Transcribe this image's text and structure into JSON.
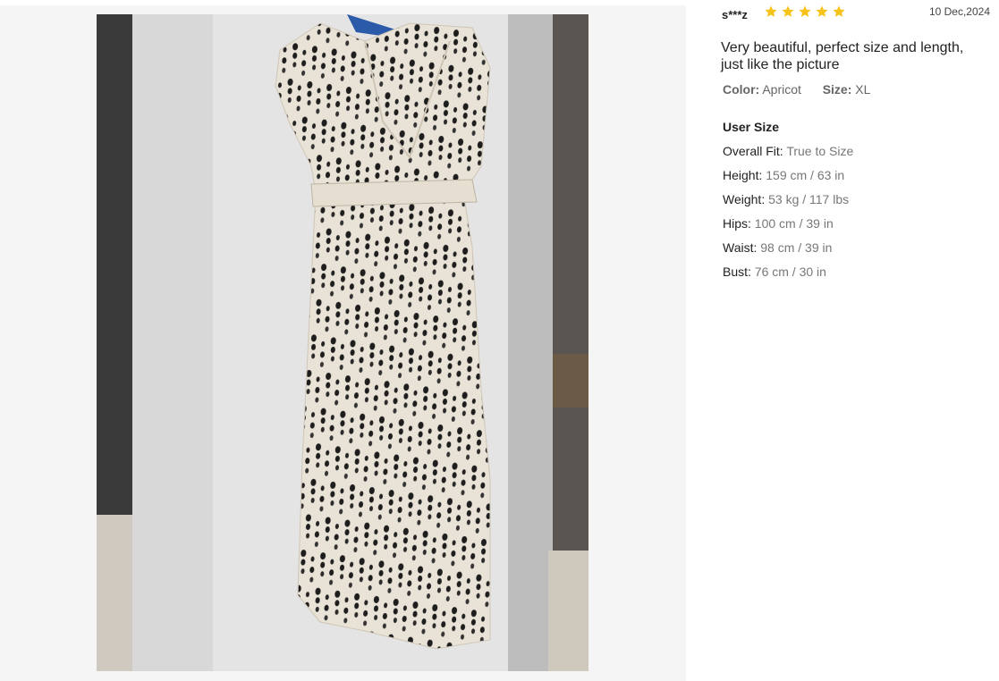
{
  "photo": {
    "subject": "dress-photo"
  },
  "review": {
    "reviewer": "s***z",
    "rating": 5,
    "rating_max": 5,
    "star_color": "#f7c31a",
    "date": "10 Dec,2024",
    "text": "Very beautiful, perfect size and length, just like the picture",
    "attributes": {
      "color_label": "Color:",
      "color_value": "Apricot",
      "size_label": "Size:",
      "size_value": "XL"
    },
    "user_size": {
      "title": "User Size",
      "rows": [
        {
          "label": "Overall Fit:",
          "value": "True to Size"
        },
        {
          "label": "Height:",
          "value": "159 cm / 63 in"
        },
        {
          "label": "Weight:",
          "value": "53 kg / 117 lbs"
        },
        {
          "label": "Hips:",
          "value": "100 cm / 39 in"
        },
        {
          "label": "Waist:",
          "value": "98 cm / 39 in"
        },
        {
          "label": "Bust:",
          "value": "76 cm / 30 in"
        }
      ]
    }
  }
}
